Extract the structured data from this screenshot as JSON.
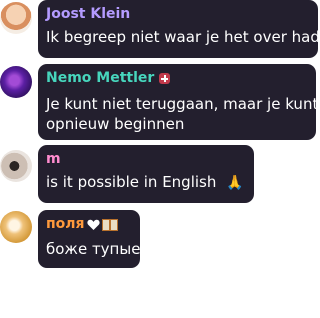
{
  "messages": [
    {
      "author": "Joost Klein",
      "author_color": "#b49bff",
      "text": "Ik begreep niet waar je het over had..",
      "avatar_icon": "person-avatar"
    },
    {
      "author": "Nemo Mettler",
      "author_color": "#47d6bd",
      "badge_icon": "swiss-cross-icon",
      "text_line1": "Je kunt niet teruggaan, maar je kunt",
      "text_line2": "opnieuw beginnen",
      "avatar_icon": "purple-glitter-avatar"
    },
    {
      "author": "m",
      "author_color": "#ff8ccf",
      "text": "is it possible in English",
      "emoji_icon": "praying-hands-icon",
      "avatar_icon": "person-avatar"
    },
    {
      "author": "поля",
      "author_color": "#ff9a3c",
      "emoji_icons": [
        "white-heart-icon",
        "gift-icon"
      ],
      "text": "боже тупые",
      "avatar_icon": "blonde-avatar"
    }
  ]
}
